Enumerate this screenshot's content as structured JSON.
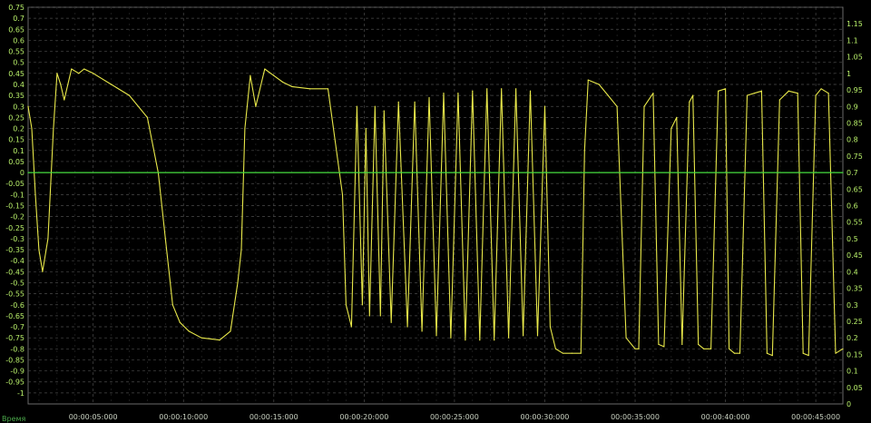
{
  "chart_data": {
    "type": "line",
    "title": "",
    "xlabel": "Время",
    "x_ticks": [
      "00:00:05:000",
      "00:00:10:000",
      "00:00:15:000",
      "00:00:20:000",
      "00:00:25:000",
      "00:00:30:000",
      "00:00:35:000",
      "00:00:40:000",
      "00:00:45:000"
    ],
    "x_tick_seconds": [
      5,
      10,
      15,
      20,
      25,
      30,
      35,
      40,
      45
    ],
    "xlim": [
      1.4,
      46.5
    ],
    "left_axis": {
      "ylim": [
        -1.05,
        0.75
      ],
      "ticks": [
        "0.75",
        "0.7",
        "0.65",
        "0.6",
        "0.55",
        "0.5",
        "0.45",
        "0.4",
        "0.35",
        "0.3",
        "0.25",
        "0.2",
        "0.15",
        "0.1",
        "0.05",
        "0",
        "-0.05",
        "-0.1",
        "-0.15",
        "-0.2",
        "-0.25",
        "-0.3",
        "-0.35",
        "-0.4",
        "-0.45",
        "-0.5",
        "-0.55",
        "-0.6",
        "-0.65",
        "-0.7",
        "-0.75",
        "-0.8",
        "-0.85",
        "-0.9",
        "-0.95",
        "-1"
      ]
    },
    "right_axis": {
      "ylim": [
        0,
        1.2
      ],
      "ticks": [
        "1.15",
        "1.1",
        "1.05",
        "1",
        "0.95",
        "0.9",
        "0.85",
        "0.8",
        "0.75",
        "0.7",
        "0.65",
        "0.6",
        "0.55",
        "0.5",
        "0.45",
        "0.4",
        "0.35",
        "0.3",
        "0.25",
        "0.2",
        "0.15",
        "0.1",
        "0.05",
        "0"
      ]
    },
    "grid": true,
    "series": [
      {
        "color": "#e8e84a",
        "axis": "left",
        "x": [
          1.4,
          1.6,
          1.8,
          2.0,
          2.2,
          2.5,
          2.8,
          3.0,
          3.2,
          3.4,
          3.8,
          4.2,
          4.5,
          5.0,
          6.0,
          7.0,
          8.0,
          8.6,
          9.0,
          9.4,
          9.8,
          10.3,
          11.0,
          12.0,
          12.6,
          13.0,
          13.2,
          13.4,
          13.7,
          14.0,
          14.5,
          15.0,
          15.5,
          16.0,
          17.0,
          18.0,
          18.8,
          19.0,
          19.3,
          19.6,
          19.9,
          20.1,
          20.3,
          20.6,
          20.9,
          21.1,
          21.5,
          21.9,
          22.4,
          22.8,
          23.2,
          23.6,
          24.0,
          24.4,
          24.8,
          25.2,
          25.6,
          26.0,
          26.4,
          26.8,
          27.2,
          27.6,
          28.0,
          28.4,
          28.8,
          29.2,
          29.6,
          30.0,
          30.3,
          30.6,
          31.0,
          31.5,
          32.0,
          32.2,
          32.4,
          33.0,
          33.5,
          34.0,
          34.5,
          35.0,
          35.2,
          35.5,
          36.0,
          36.3,
          36.6,
          37.0,
          37.3,
          37.6,
          38.0,
          38.2,
          38.5,
          38.8,
          39.2,
          39.6,
          40.0,
          40.2,
          40.5,
          40.8,
          41.2,
          41.6,
          42.0,
          42.3,
          42.6,
          43.0,
          43.5,
          44.0,
          44.3,
          44.6,
          45.0,
          45.3,
          45.7,
          46.1,
          46.5
        ],
        "y": [
          0.3,
          0.2,
          -0.1,
          -0.35,
          -0.45,
          -0.3,
          0.2,
          0.45,
          0.4,
          0.33,
          0.47,
          0.45,
          0.47,
          0.45,
          0.4,
          0.35,
          0.25,
          0.0,
          -0.3,
          -0.6,
          -0.68,
          -0.72,
          -0.75,
          -0.76,
          -0.72,
          -0.5,
          -0.35,
          0.2,
          0.44,
          0.3,
          0.47,
          0.44,
          0.41,
          0.39,
          0.38,
          0.38,
          -0.1,
          -0.6,
          -0.7,
          0.3,
          -0.6,
          0.2,
          -0.65,
          0.3,
          -0.65,
          0.28,
          -0.68,
          0.32,
          -0.7,
          0.32,
          -0.72,
          0.34,
          -0.74,
          0.36,
          -0.75,
          0.36,
          -0.76,
          0.37,
          -0.76,
          0.38,
          -0.76,
          0.38,
          -0.75,
          0.38,
          -0.74,
          0.37,
          -0.74,
          0.3,
          -0.7,
          -0.8,
          -0.82,
          -0.82,
          -0.82,
          0.1,
          0.42,
          0.4,
          0.35,
          0.3,
          -0.75,
          -0.8,
          -0.8,
          0.3,
          0.36,
          -0.78,
          -0.79,
          0.2,
          0.25,
          -0.78,
          0.32,
          0.35,
          -0.78,
          -0.8,
          -0.8,
          0.37,
          0.38,
          -0.8,
          -0.82,
          -0.82,
          0.35,
          0.36,
          0.37,
          -0.82,
          -0.83,
          0.33,
          0.37,
          0.36,
          -0.82,
          -0.83,
          0.35,
          0.38,
          0.36,
          -0.82,
          -0.8
        ]
      },
      {
        "color": "#3cdc3c",
        "axis": "left",
        "x": [
          1.4,
          46.5
        ],
        "y": [
          0.0,
          0.0
        ]
      }
    ]
  }
}
